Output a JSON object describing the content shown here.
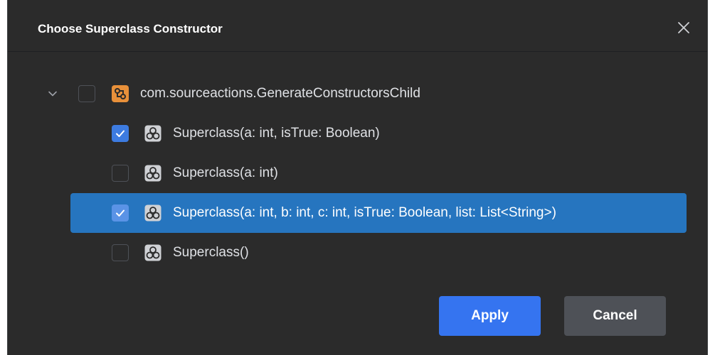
{
  "dialog": {
    "title": "Choose Superclass Constructor",
    "close_icon": "close-icon"
  },
  "tree": {
    "root": {
      "label": "com.sourceactions.GenerateConstructorsChild",
      "expanded": true,
      "checked": false,
      "icon": "class-icon"
    },
    "items": [
      {
        "label": "Superclass(a: int, isTrue: Boolean)",
        "checked": true,
        "selected": false,
        "icon": "constructor-icon"
      },
      {
        "label": "Superclass(a: int)",
        "checked": false,
        "selected": false,
        "icon": "constructor-icon"
      },
      {
        "label": "Superclass(a: int, b: int, c: int, isTrue: Boolean, list: List<String>)",
        "checked": true,
        "selected": true,
        "icon": "constructor-icon"
      },
      {
        "label": "Superclass()",
        "checked": false,
        "selected": false,
        "icon": "constructor-icon"
      }
    ]
  },
  "buttons": {
    "apply_label": "Apply",
    "cancel_label": "Cancel"
  },
  "colors": {
    "dialog_bg": "#2b2b2b",
    "selection_bg": "#2675bf",
    "checkbox_checked": "#3d7be0",
    "apply_bg": "#3574f0",
    "cancel_bg": "#4e5157",
    "class_icon": "#e8903a"
  }
}
